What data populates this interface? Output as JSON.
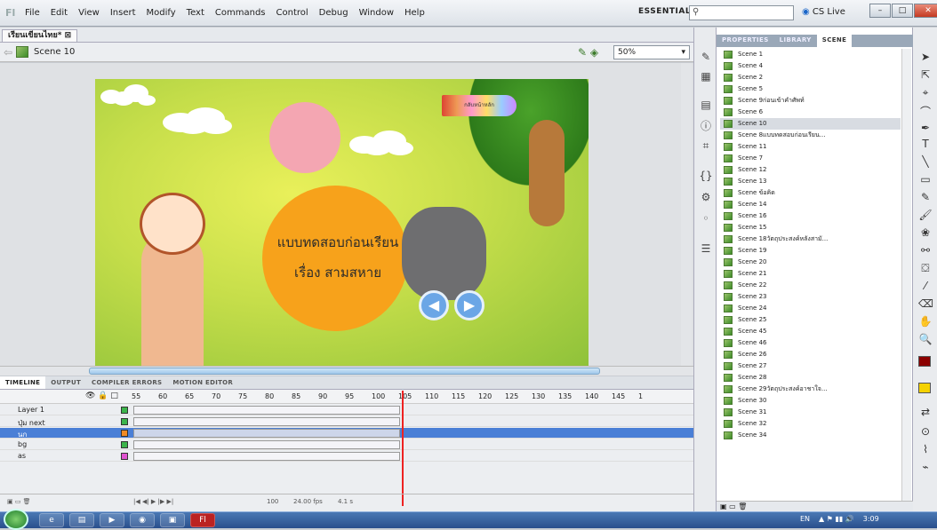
{
  "app": {
    "logo": "Fl"
  },
  "menu": [
    "File",
    "Edit",
    "View",
    "Insert",
    "Modify",
    "Text",
    "Commands",
    "Control",
    "Debug",
    "Window",
    "Help"
  ],
  "essentials": "ESSENTIALS ▾",
  "search": {
    "icon": "search-icon"
  },
  "cslive": "CS Live",
  "doc_tab": "เรียนเขียนไทย*",
  "scene_label": "Scene 10",
  "zoom": "50%",
  "stage": {
    "title_line1": "แบบทดสอบก่อนเรียน",
    "title_line2": "เรื่อง สามสหาย",
    "pencil_text": "กลับหน้าหลัก"
  },
  "panel_tabs": [
    "PROPERTIES",
    "LIBRARY",
    "SCENE"
  ],
  "scenes": [
    "Scene 1",
    "Scene 4",
    "Scene 2",
    "Scene 5",
    "Scene 9ก่อนเข้าคำศัพท์",
    "Scene 6",
    "Scene 10",
    "Scene 8แบบทดสอบก่อนเรียน...",
    "Scene 11",
    "Scene 7",
    "Scene 12",
    "Scene 13",
    "Scene ข้อคิด",
    "Scene 14",
    "Scene 16",
    "Scene 15",
    "Scene 18วัตถุประสงค์หลังสามั...",
    "Scene 19",
    "Scene 20",
    "Scene 21",
    "Scene 22",
    "Scene 23",
    "Scene 24",
    "Scene 25",
    "Scene 45",
    "Scene 46",
    "Scene 26",
    "Scene 27",
    "Scene 28",
    "Scene 29วัตถุประสงค์อาชาใจ...",
    "Scene 30",
    "Scene 31",
    "Scene 32",
    "Scene 34"
  ],
  "selected_scene_index": 6,
  "timeline_tabs": [
    "TIMELINE",
    "OUTPUT",
    "COMPILER ERRORS",
    "MOTION EDITOR"
  ],
  "frame_numbers": [
    "55",
    "60",
    "65",
    "70",
    "75",
    "80",
    "85",
    "90",
    "95",
    "100",
    "105",
    "110",
    "115",
    "120",
    "125",
    "130",
    "135",
    "140",
    "145",
    "1"
  ],
  "layers": [
    {
      "name": "Layer 1",
      "color": "#3cb44b",
      "selected": false
    },
    {
      "name": "ปุ่ม next",
      "color": "#3cb44b",
      "selected": false
    },
    {
      "name": "นก",
      "color": "#f08a24",
      "selected": true
    },
    {
      "name": "bg",
      "color": "#3cb44b",
      "selected": false
    },
    {
      "name": "as",
      "color": "#e052d0",
      "selected": false
    }
  ],
  "timeline_footer": {
    "frame": "100",
    "fps": "24.00 fps",
    "time": "4.1 s"
  },
  "tray": {
    "lang": "EN",
    "time": "3:09"
  },
  "colors": {
    "stroke": "#8b0000",
    "fill": "#f5d200",
    "accent": "#1b66c9"
  }
}
